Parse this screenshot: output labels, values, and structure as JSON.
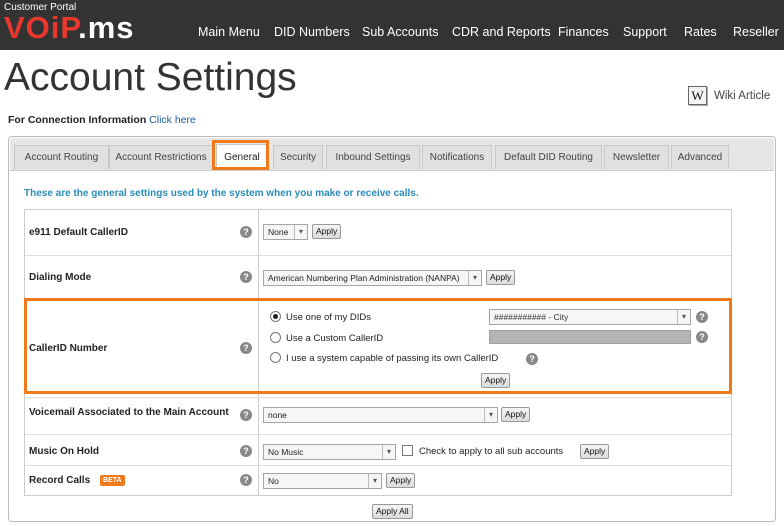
{
  "header": {
    "portal_label": "Customer Portal",
    "logo_part1": "VOiP",
    "logo_part2": ".ms",
    "nav": [
      "Main Menu",
      "DID Numbers",
      "Sub Accounts",
      "CDR and Reports",
      "Finances",
      "Support",
      "Rates",
      "Reseller"
    ]
  },
  "page": {
    "title": "Account Settings",
    "wiki_icon": "W",
    "wiki_label": "Wiki Article",
    "conn_info_text": "For Connection Information",
    "conn_info_link": "Click here"
  },
  "tabs": [
    {
      "label": "Account Routing",
      "active": false
    },
    {
      "label": "Account Restrictions",
      "active": false
    },
    {
      "label": "General",
      "active": true
    },
    {
      "label": "Security",
      "active": false
    },
    {
      "label": "Inbound Settings",
      "active": false
    },
    {
      "label": "Notifications",
      "active": false
    },
    {
      "label": "Default DID Routing",
      "active": false
    },
    {
      "label": "Newsletter",
      "active": false
    },
    {
      "label": "Advanced",
      "active": false
    }
  ],
  "general": {
    "intro": "These are the general settings used by the system when you make or receive calls.",
    "help_glyph": "?",
    "e911": {
      "label": "e911 Default CallerID",
      "value": "None",
      "apply": "Apply"
    },
    "dialing_mode": {
      "label": "Dialing Mode",
      "value": "American Numbering Plan Administration (NANPA)",
      "apply": "Apply"
    },
    "callerid": {
      "label": "CallerID Number",
      "opt1": "Use one of my DIDs",
      "opt2": "Use a Custom CallerID",
      "opt3": "I use a system capable of passing its own CallerID",
      "did_value": "########### - City",
      "apply": "Apply",
      "selected_option": 1
    },
    "voicemail": {
      "label": "Voicemail Associated to the Main Account",
      "value": "none",
      "apply": "Apply"
    },
    "music_on_hold": {
      "label": "Music On Hold",
      "value": "No Music",
      "checkbox_label": "Check to apply to all sub accounts",
      "apply": "Apply"
    },
    "record_calls": {
      "label": "Record Calls",
      "badge": "BETA",
      "value": "No",
      "apply": "Apply"
    },
    "apply_all": "Apply All"
  },
  "colors": {
    "accent": "#f07a1a",
    "logo_red": "#e8382c",
    "header_bg": "#333333",
    "intro_blue": "#2a8db8"
  }
}
